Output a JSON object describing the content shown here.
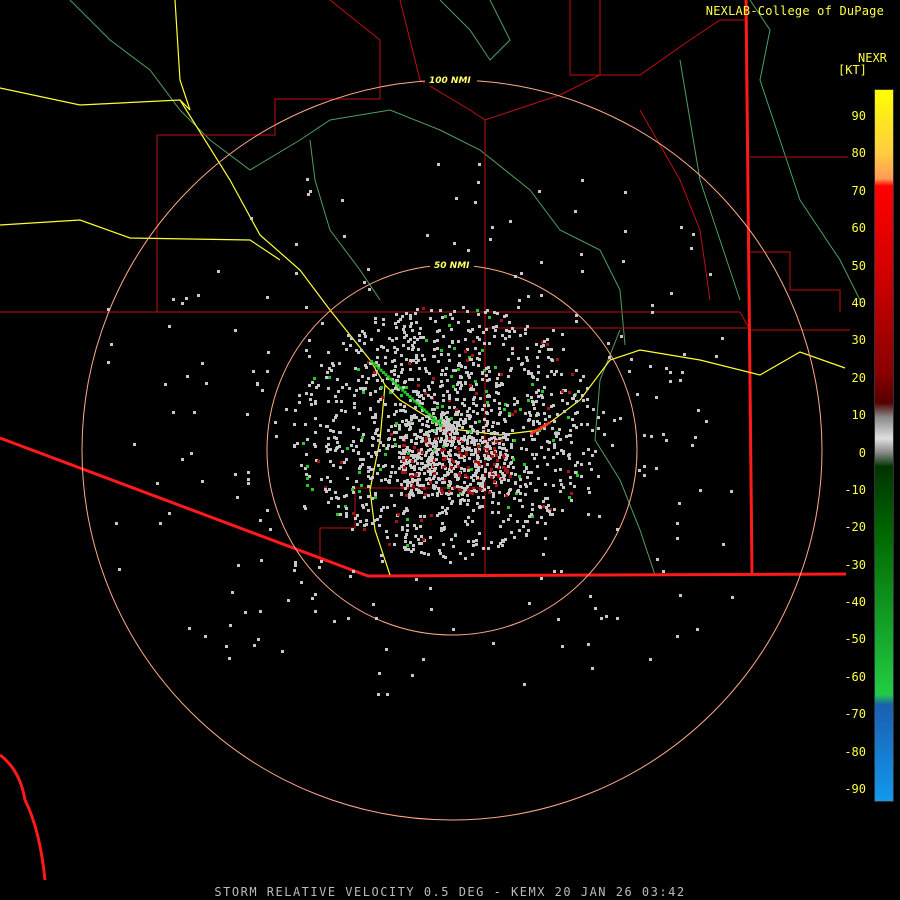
{
  "credit": "NEXLAB-College of DuPage",
  "scale": {
    "product": "NEXR",
    "unit": "[KT]",
    "ticks": [
      "90",
      "80",
      "70",
      "60",
      "50",
      "40",
      "30",
      "20",
      "10",
      "0",
      "-10",
      "-20",
      "-30",
      "-40",
      "-50",
      "-60",
      "-70",
      "-80",
      "-90"
    ]
  },
  "rings": {
    "inner_label": "50 NMI",
    "outer_label": "100 NMI"
  },
  "caption": "STORM RELATIVE VELOCITY 0.5 DEG - KEMX 20 JAN 26 03:42",
  "colors": {
    "state_border": "#ff2020",
    "county_border": "#cc1111",
    "highway": "#ffff33",
    "river": "#55aa55",
    "range_ring": "#ffaa88",
    "echo_gray": "#c8c8c8",
    "echo_green": "#22cc22",
    "echo_red": "#aa1111"
  }
}
